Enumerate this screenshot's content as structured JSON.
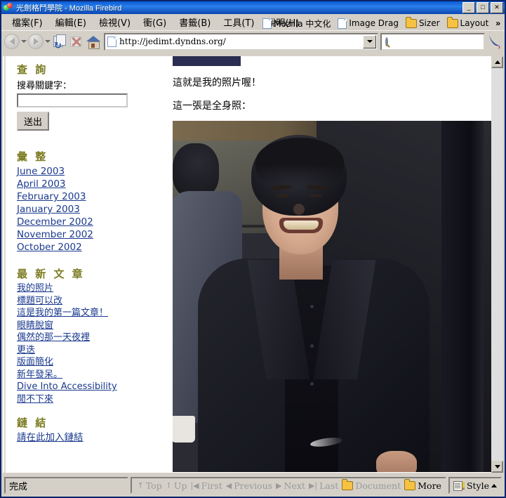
{
  "window": {
    "title": "光劍格鬥學院 - Mozilla Firebird",
    "minimize": "_",
    "maximize": "□",
    "close": "✕"
  },
  "menu": {
    "items": [
      {
        "label": "檔案(F)"
      },
      {
        "label": "編輯(E)"
      },
      {
        "label": "檢視(V)"
      },
      {
        "label": "衝(G)"
      },
      {
        "label": "書籤(B)"
      },
      {
        "label": "工具(T)"
      },
      {
        "label": "說明(H)"
      }
    ]
  },
  "personal_toolbar": {
    "items": [
      {
        "label": "Mozilla 中文化",
        "icon": "document-icon"
      },
      {
        "label": "Image Drag",
        "icon": "document-icon"
      },
      {
        "label": "Sizer",
        "icon": "folder-icon"
      },
      {
        "label": "Layout",
        "icon": "folder-icon"
      }
    ],
    "overflow": "»"
  },
  "navigation": {
    "back": "back-icon",
    "forward": "forward-icon",
    "reload": "reload-icon",
    "stop": "stop-icon",
    "home": "home-icon",
    "url_value": "http://jedimt.dyndns.org/",
    "url_placeholder": "",
    "search_value": "",
    "search_placeholder": ""
  },
  "sidebar": {
    "search": {
      "heading": "查 詢",
      "label": "搜尋關鍵字：",
      "input_value": "",
      "button": "送出"
    },
    "archive": {
      "heading": "彙 整",
      "items": [
        "June 2003",
        "April 2003",
        "February 2003",
        "January 2003",
        "December 2002",
        "November 2002",
        "October 2002"
      ]
    },
    "recent": {
      "heading": "最 新 文 章",
      "items": [
        "我的照片",
        "標題可以改",
        "這是我的第一篇文章！",
        "眼睛脫窗",
        "偶然的那一天夜裡",
        "更迭",
        "版面簡化",
        "新年發呆。",
        "Dive Into Accessibility",
        "閒不下來"
      ]
    },
    "links": {
      "heading": "鏈 結",
      "items": [
        "請在此加入鏈結"
      ]
    }
  },
  "main": {
    "caption_1": "這就是我的照片喔！",
    "caption_2": "這一張是全身照：",
    "photo_alt": "全身照 - 穿深色西裝微笑的男子"
  },
  "statusbar": {
    "message": "完成",
    "nav": [
      {
        "label": "Top",
        "glyph": "⤒",
        "enabled": false
      },
      {
        "label": "Up",
        "glyph": "↑",
        "enabled": false
      },
      {
        "label": "First",
        "glyph": "|◀",
        "enabled": false
      },
      {
        "label": "Previous",
        "glyph": "◀",
        "enabled": false
      },
      {
        "label": "Next",
        "glyph": "▶",
        "enabled": false
      },
      {
        "label": "Last",
        "glyph": "▶|",
        "enabled": false
      },
      {
        "label": "Document",
        "glyph": "folder-icon",
        "enabled": false
      },
      {
        "label": "More",
        "glyph": "folder-icon",
        "enabled": true
      }
    ],
    "style_label": "Style"
  },
  "colors": {
    "titlebar": "#0a5ad6",
    "chrome": "#d4d0c8",
    "heading": "#7b7b22",
    "link": "#1a3a8f"
  }
}
